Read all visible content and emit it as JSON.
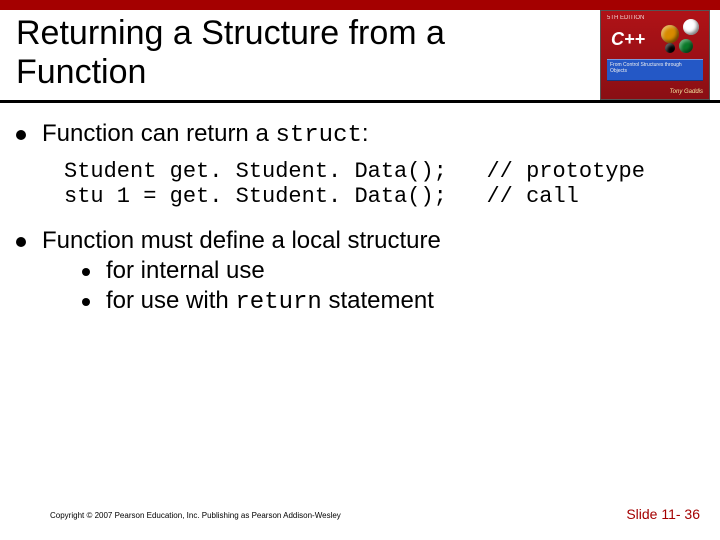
{
  "slide": {
    "title": "Returning a Structure from a Function",
    "cover": {
      "top_label": "5TH EDITION",
      "logo_text": "C++",
      "panel_text": "From Control Structures through Objects",
      "author": "Tony Gaddis"
    },
    "bullets": {
      "b1_prefix": "Function can return a ",
      "b1_code": "struct",
      "b1_suffix": ":",
      "code_line1": "Student get. Student. Data();   // prototype",
      "code_line2": "stu 1 = get. Student. Data();   // call",
      "b2_text": "Function must define a local structure",
      "b2_sub1": "for internal use",
      "b2_sub2_prefix": "for use with ",
      "b2_sub2_code": "return",
      "b2_sub2_suffix": " statement"
    },
    "footer": {
      "copyright": "Copyright © 2007 Pearson Education, Inc. Publishing as Pearson Addison-Wesley",
      "slide_no": "Slide 11- 36"
    }
  }
}
